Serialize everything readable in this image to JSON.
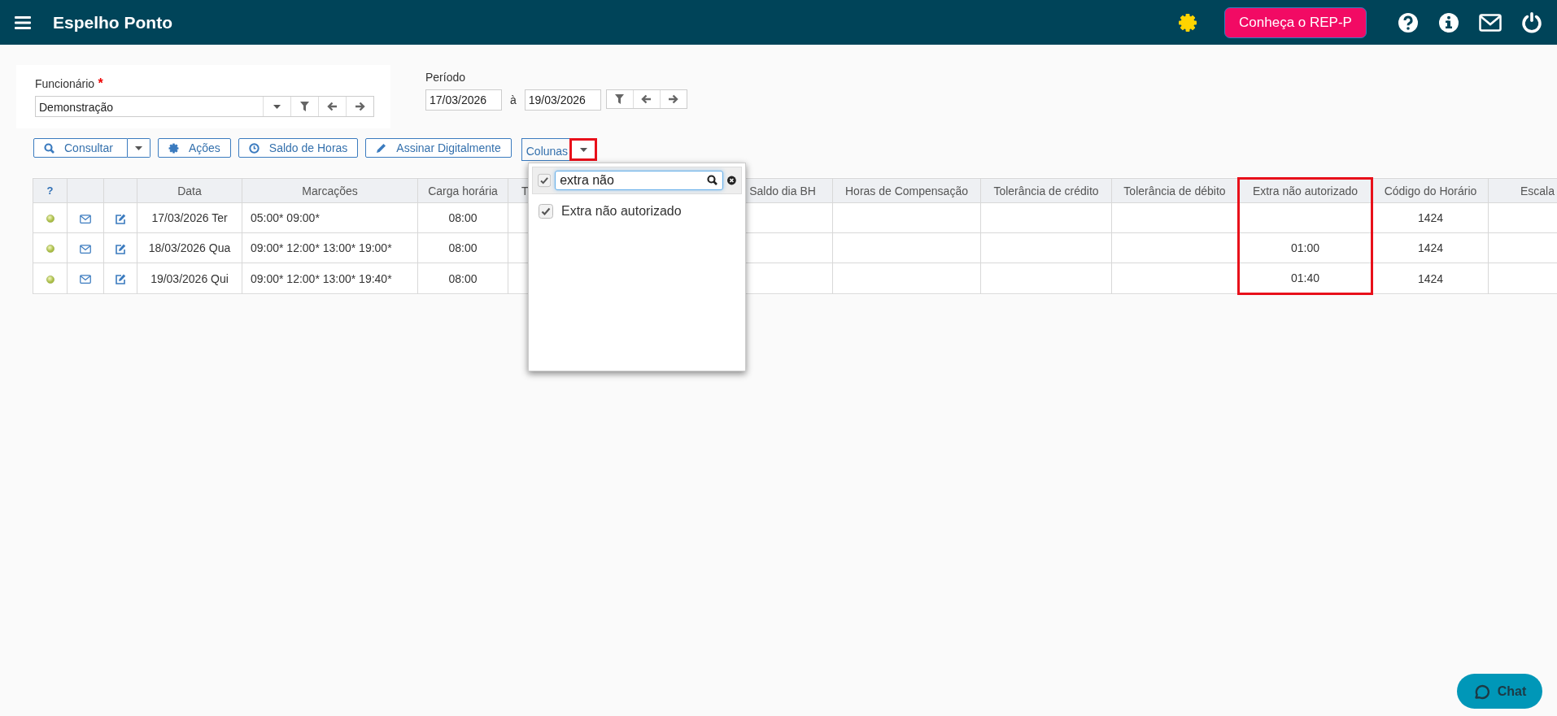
{
  "header": {
    "title": "Espelho Ponto",
    "promo_button": "Conheça o REP-P"
  },
  "employee": {
    "label": "Funcionário",
    "required_mark": "*",
    "value": "Demonstração"
  },
  "period": {
    "label": "Período",
    "from": "17/03/2026",
    "separator": "à",
    "to": "19/03/2026"
  },
  "toolbar": {
    "buttons": [
      {
        "kind": "search",
        "label": "Consultar"
      },
      {
        "kind": "actions",
        "label": "Ações"
      },
      {
        "kind": "clock",
        "label": "Saldo de Horas"
      },
      {
        "kind": "sign",
        "label": "Assinar Digitalmente"
      }
    ],
    "columns_menu": {
      "label": "Colunas",
      "highlighted": true
    }
  },
  "column_picker": {
    "select_all_checked": true,
    "search_value": "extra não",
    "options": [
      {
        "label": "Extra não autorizado",
        "checked": true
      }
    ]
  },
  "table": {
    "columns": [
      {
        "kind": "help",
        "label": "?",
        "highlighted": false
      },
      {
        "kind": "mail",
        "highlighted": false
      },
      {
        "kind": "edit",
        "highlighted": false
      },
      {
        "kind": "date",
        "label": "Data",
        "highlighted": false
      },
      {
        "kind": "marks",
        "label": "Marcações",
        "highlighted": false
      },
      {
        "kind": "workload",
        "label": "Carga horária",
        "highlighted": false
      },
      {
        "kind": "text",
        "label": "T",
        "highlighted": false
      },
      {
        "kind": "text",
        "label": "Saldo dia BH",
        "highlighted": false
      },
      {
        "kind": "text",
        "label": "Horas de Compensação",
        "highlighted": false
      },
      {
        "kind": "text",
        "label": "Tolerância de crédito",
        "highlighted": false
      },
      {
        "kind": "text",
        "label": "Tolerância de débito",
        "highlighted": false
      },
      {
        "kind": "extra",
        "label": "Extra não autorizado",
        "highlighted": true
      },
      {
        "kind": "code",
        "label": "Código do Horário",
        "highlighted": false
      },
      {
        "kind": "text",
        "label": "Escala",
        "highlighted": false
      }
    ],
    "rows": [
      {
        "date": "17/03/2026 Ter",
        "marks": "05:00* 09:00*",
        "workload": "08:00",
        "code": "1424"
      },
      {
        "date": "18/03/2026 Qua",
        "marks": "09:00* 12:00* 13:00* 19:00*",
        "workload": "08:00",
        "extra": "01:00",
        "code": "1424"
      },
      {
        "date": "19/03/2026 Qui",
        "marks": "09:00* 12:00* 13:00* 19:40*",
        "workload": "08:00",
        "extra": "01:40",
        "code": "1424"
      }
    ]
  },
  "chat_button": "Chat"
}
